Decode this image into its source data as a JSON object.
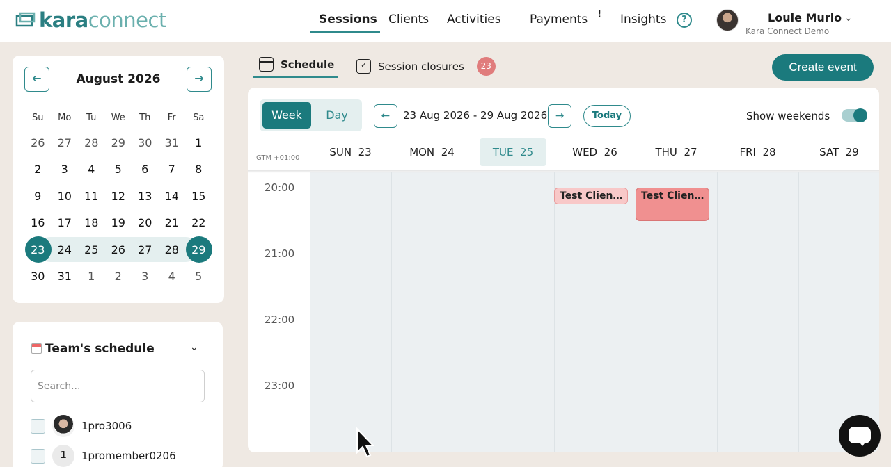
{
  "app": {
    "logo_part1": "kara",
    "logo_part2": "connect"
  },
  "nav": {
    "items": [
      "Sessions",
      "Clients",
      "Activities",
      "Payments",
      "Insights"
    ],
    "payments_mark": "!",
    "help_icon": "question-circle-icon"
  },
  "user": {
    "name": "Louie Murio",
    "org": "Kara Connect Demo"
  },
  "mini_calendar": {
    "month_label": "August 2026",
    "weekdays": [
      "Su",
      "Mo",
      "Tu",
      "We",
      "Th",
      "Fr",
      "Sa"
    ],
    "weeks": [
      [
        "26",
        "27",
        "28",
        "29",
        "30",
        "31",
        "1"
      ],
      [
        "2",
        "3",
        "4",
        "5",
        "6",
        "7",
        "8"
      ],
      [
        "9",
        "10",
        "11",
        "12",
        "13",
        "14",
        "15"
      ],
      [
        "16",
        "17",
        "18",
        "19",
        "20",
        "21",
        "22"
      ],
      [
        "23",
        "24",
        "25",
        "26",
        "27",
        "28",
        "29"
      ],
      [
        "30",
        "31",
        "1",
        "2",
        "3",
        "4",
        "5"
      ]
    ],
    "selected_week_index": 4,
    "selected_start": "23",
    "selected_end": "29",
    "prev_icon": "arrow-left-icon",
    "next_icon": "arrow-right-icon"
  },
  "team": {
    "title": "Team's schedule",
    "search_placeholder": "Search...",
    "members": [
      {
        "name": "1pro3006",
        "avatar": "photo"
      },
      {
        "name": "1promember0206",
        "initial": "1"
      }
    ]
  },
  "subtabs": {
    "schedule": "Schedule",
    "closures": "Session closures",
    "closures_count": "23"
  },
  "create_event_label": "Create event",
  "view": {
    "week_label": "Week",
    "day_label": "Day",
    "range_label": "23 Aug 2026 - 29 Aug 2026",
    "today_label": "Today",
    "show_weekends_label": "Show weekends",
    "show_weekends_on": true
  },
  "schedule": {
    "timezone_label": "GTM +01:00",
    "days": [
      {
        "name": "SUN",
        "date": "23"
      },
      {
        "name": "MON",
        "date": "24"
      },
      {
        "name": "TUE",
        "date": "25",
        "today": true
      },
      {
        "name": "WED",
        "date": "26"
      },
      {
        "name": "THU",
        "date": "27"
      },
      {
        "name": "FRI",
        "date": "28"
      },
      {
        "name": "SAT",
        "date": "29"
      }
    ],
    "times": [
      "20:00",
      "21:00",
      "22:00",
      "23:00"
    ],
    "events": [
      {
        "title": "Test Client...",
        "day": "WED",
        "start": "20:00"
      },
      {
        "title": "Test Client...",
        "day": "THU",
        "start": "20:00"
      }
    ]
  },
  "colors": {
    "primary": "#1b7a7d",
    "accent_light": "#e4efef",
    "event_light": "#f8c8c8",
    "event_strong": "#f09090",
    "badge": "#e07c7c"
  }
}
